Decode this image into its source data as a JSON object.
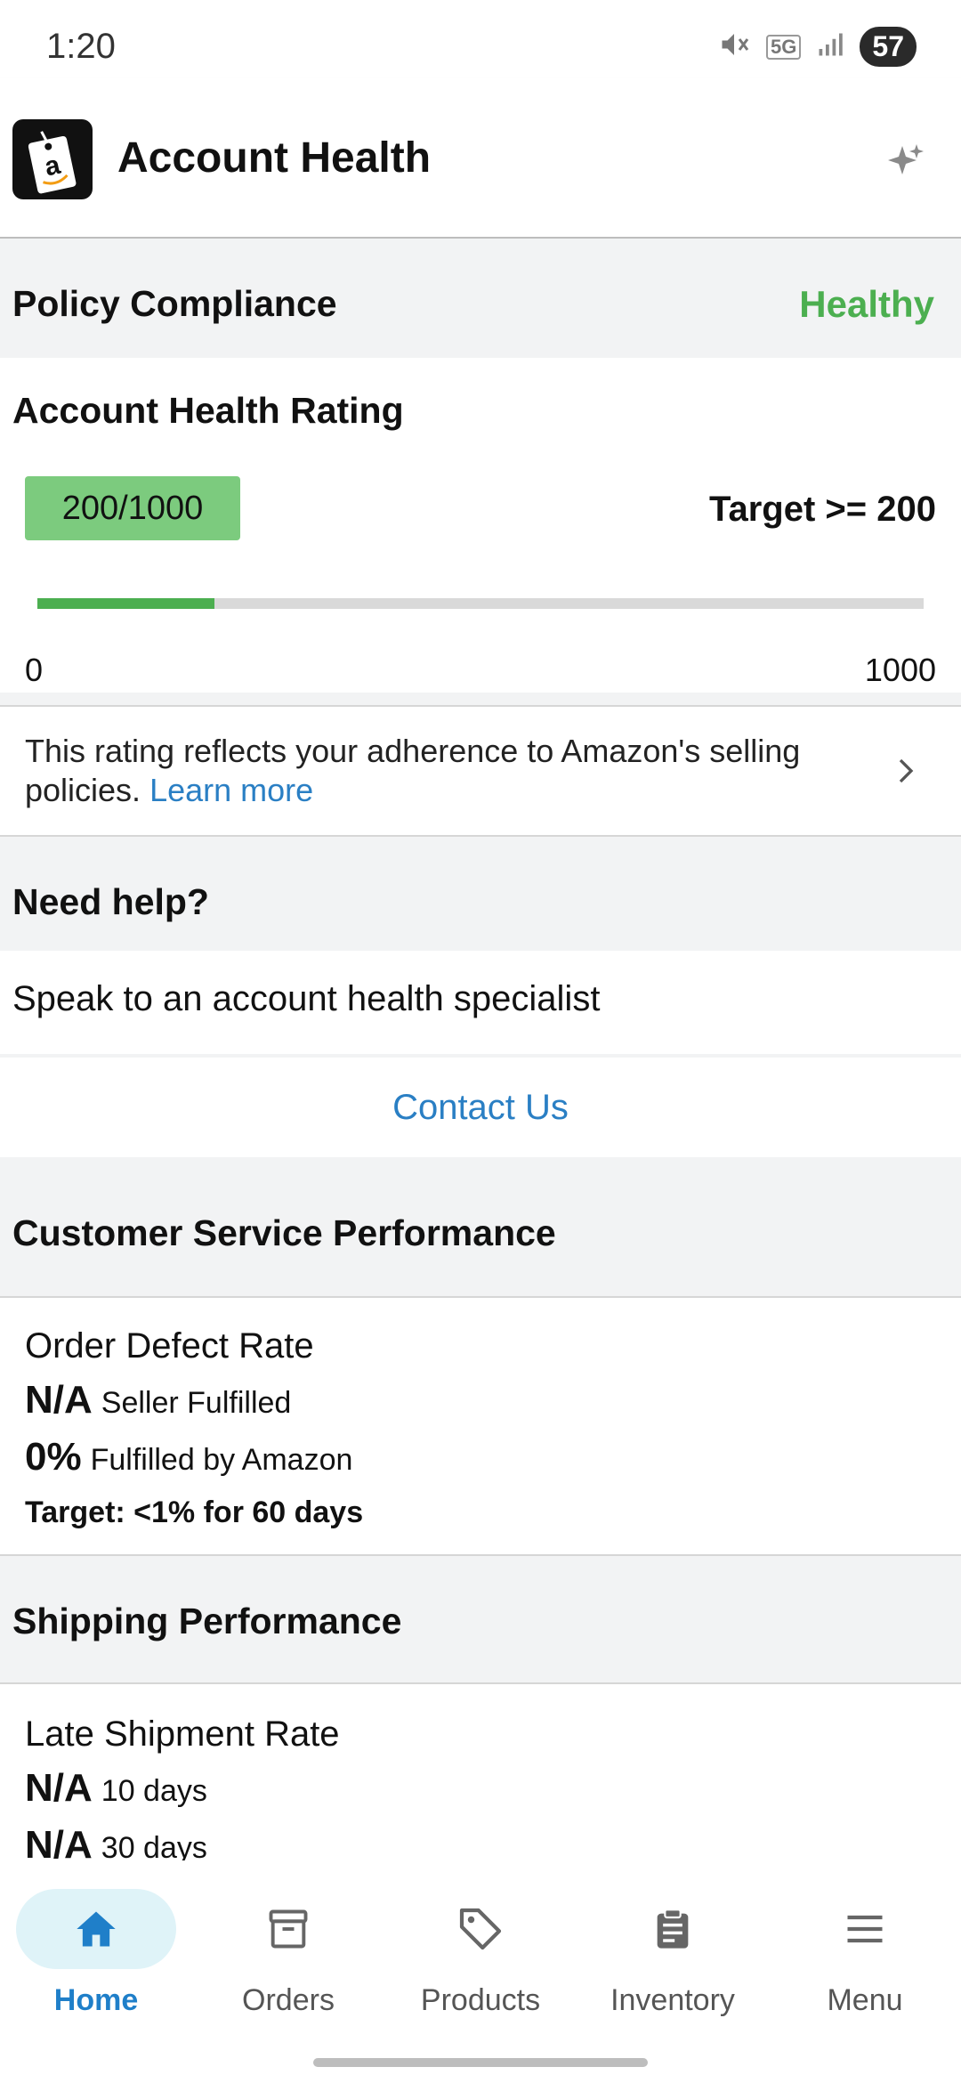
{
  "status_bar": {
    "time": "1:20",
    "network": "5G",
    "battery": "57"
  },
  "app_bar": {
    "title": "Account Health",
    "logo_icon": "amazon-tag-icon",
    "assist_icon": "sparkle-icon"
  },
  "policy": {
    "title": "Policy Compliance",
    "status": "Healthy",
    "status_color": "#4caf50"
  },
  "rating": {
    "title": "Account Health Rating",
    "score": "200/1000",
    "target": "Target >= 200",
    "progress_fraction": 0.2,
    "axis_min": "0",
    "axis_max": "1000",
    "info_text": "This rating reflects your adherence to Amazon's selling policies.",
    "learn_more": "Learn more"
  },
  "help": {
    "title": "Need help?",
    "speak": "Speak to an account health specialist",
    "contact": "Contact Us"
  },
  "customer_service": {
    "title": "Customer Service Performance",
    "metric": "Order Defect Rate",
    "seller_value": "N/A",
    "seller_label": "Seller Fulfilled",
    "fba_value": "0%",
    "fba_label": "Fulfilled by Amazon",
    "target": "Target: <1% for 60 days"
  },
  "shipping": {
    "title": "Shipping Performance",
    "metric": "Late Shipment Rate",
    "row1_value": "N/A",
    "row1_label": "10 days",
    "row2_value": "N/A",
    "row2_label": "30 days"
  },
  "nav": {
    "items": [
      {
        "label": "Home",
        "icon": "home-icon",
        "active": true
      },
      {
        "label": "Orders",
        "icon": "orders-box-icon",
        "active": false
      },
      {
        "label": "Products",
        "icon": "tag-icon",
        "active": false
      },
      {
        "label": "Inventory",
        "icon": "clipboard-icon",
        "active": false
      },
      {
        "label": "Menu",
        "icon": "hamburger-menu-icon",
        "active": false
      }
    ]
  },
  "colors": {
    "accent_blue": "#1f7fc9",
    "link_blue": "#2a7fc4",
    "healthy_green": "#4caf50",
    "badge_green": "#7ccb7e"
  }
}
